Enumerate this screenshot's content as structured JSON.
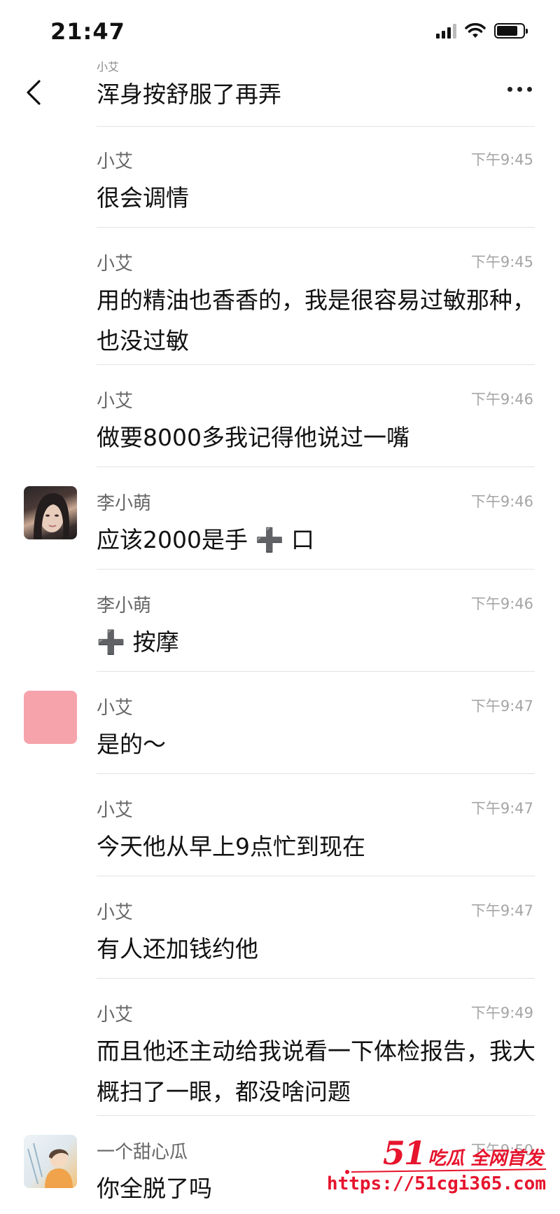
{
  "status_bar": {
    "time": "21:47",
    "signal_icon": "cellular-signal-icon",
    "wifi_icon": "wifi-icon",
    "battery_icon": "battery-icon"
  },
  "nav": {
    "top_fragment": "小艾",
    "title": "浑身按舒服了再弄",
    "back_icon": "chevron-left-icon",
    "more_icon": "more-dots-icon"
  },
  "messages": [
    {
      "sender": "小艾",
      "time": "下午9:45",
      "text": "很会调情",
      "avatar": "none"
    },
    {
      "sender": "小艾",
      "time": "下午9:45",
      "text": "用的精油也香香的，我是很容易过敏那种，也没过敏",
      "avatar": "none"
    },
    {
      "sender": "小艾",
      "time": "下午9:46",
      "text": "做要8000多我记得他说过一嘴",
      "avatar": "none"
    },
    {
      "sender": "李小萌",
      "time": "下午9:46",
      "text": "应该2000是手 ➕ 口",
      "avatar": "photo-woman"
    },
    {
      "sender": "李小萌",
      "time": "下午9:46",
      "text": "➕ 按摩",
      "avatar": "none"
    },
    {
      "sender": "小艾",
      "time": "下午9:47",
      "text": "是的～",
      "avatar": "pink-square"
    },
    {
      "sender": "小艾",
      "time": "下午9:47",
      "text": "今天他从早上9点忙到现在",
      "avatar": "none"
    },
    {
      "sender": "小艾",
      "time": "下午9:47",
      "text": "有人还加钱约他",
      "avatar": "none"
    },
    {
      "sender": "小艾",
      "time": "下午9:49",
      "text": "而且他还主动给我说看一下体检报告，我大概扫了一眼，都没啥问题",
      "avatar": "none"
    },
    {
      "sender": "一个甜心瓜",
      "time": "下午9:50",
      "text": "你全脱了吗",
      "avatar": "photo-illustration"
    }
  ],
  "watermark": {
    "brand": "51",
    "slogan": "吃瓜 全网首发",
    "url": "https://51cgi365.com"
  },
  "colors": {
    "divider": "#e3e3e3",
    "sender": "#666666",
    "time": "#a5a5a5",
    "pink_avatar": "#f6a3ac",
    "watermark": "#e6142d"
  }
}
